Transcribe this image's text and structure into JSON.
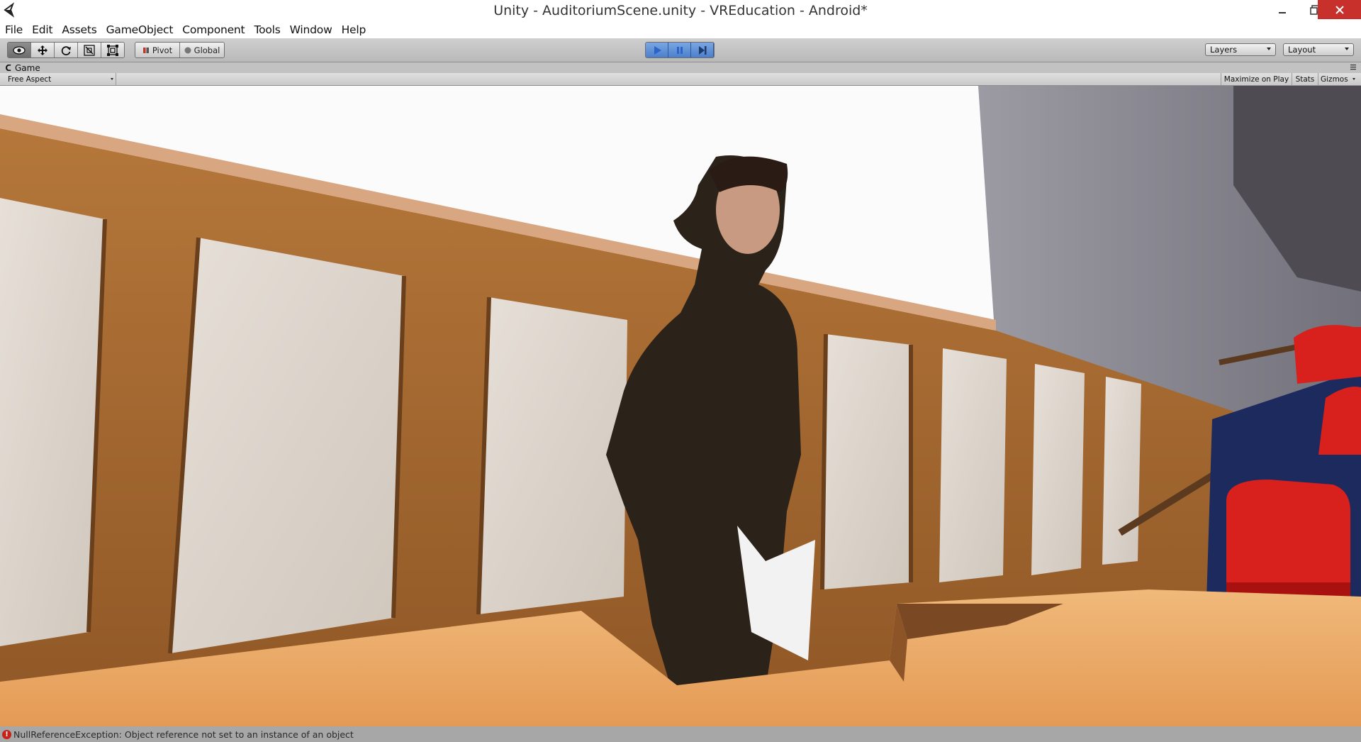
{
  "window": {
    "title": "Unity - AuditoriumScene.unity - VREducation - Android*",
    "minimize_icon": "minimize-icon",
    "maximize_icon": "restore-icon",
    "close_icon": "close-icon"
  },
  "menubar": {
    "items": [
      "File",
      "Edit",
      "Assets",
      "GameObject",
      "Component",
      "Tools",
      "Window",
      "Help"
    ]
  },
  "toolbar": {
    "transform_tools": [
      "hand-tool-icon",
      "move-tool-icon",
      "rotate-tool-icon",
      "scale-tool-icon",
      "rect-tool-icon"
    ],
    "pivot_label": "Pivot",
    "global_label": "Global",
    "play_controls": [
      "play-icon",
      "pause-icon",
      "step-icon"
    ],
    "play_accent": "#4b7fcb",
    "layers_label": "Layers",
    "layout_label": "Layout"
  },
  "game_view": {
    "tab_label": "Game",
    "aspect_label": "Free Aspect",
    "maximize_label": "Maximize on Play",
    "stats_label": "Stats",
    "gizmos_label": "Gizmos"
  },
  "console": {
    "message": "NullReferenceException: Object reference not set to an instance of an object",
    "error_color": "#c8211a"
  }
}
